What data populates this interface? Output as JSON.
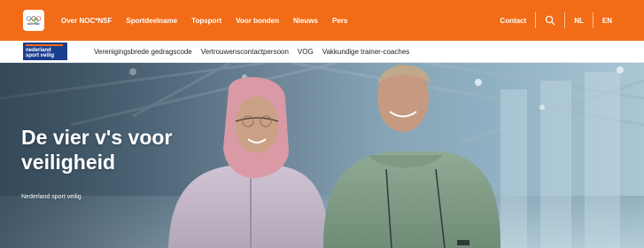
{
  "topnav": {
    "logo_text": "NOC*NSF",
    "items": [
      {
        "label": "Over NOC*NSF"
      },
      {
        "label": "Sportdeelname"
      },
      {
        "label": "Topsport"
      },
      {
        "label": "Voor bonden"
      },
      {
        "label": "Nieuws"
      },
      {
        "label": "Pers"
      }
    ],
    "contact_label": "Contact",
    "search_icon": "search-icon",
    "languages": [
      "NL",
      "EN"
    ],
    "colors": {
      "background": "#f26b16",
      "text": "#ffffff"
    }
  },
  "subnav": {
    "logo_line1": "nederland",
    "logo_line2": "sport veilig",
    "items": [
      {
        "label": "Verenigingsbrede gedragscode"
      },
      {
        "label": "Vertrouwenscontactpersoon"
      },
      {
        "label": "VOG"
      },
      {
        "label": "Vakkundige trainer-coaches"
      }
    ],
    "colors": {
      "logo_background": "#1b3f8f"
    }
  },
  "hero": {
    "title": "De vier v's voor veiligheid",
    "subtitle": "Nederland sport veilig"
  }
}
